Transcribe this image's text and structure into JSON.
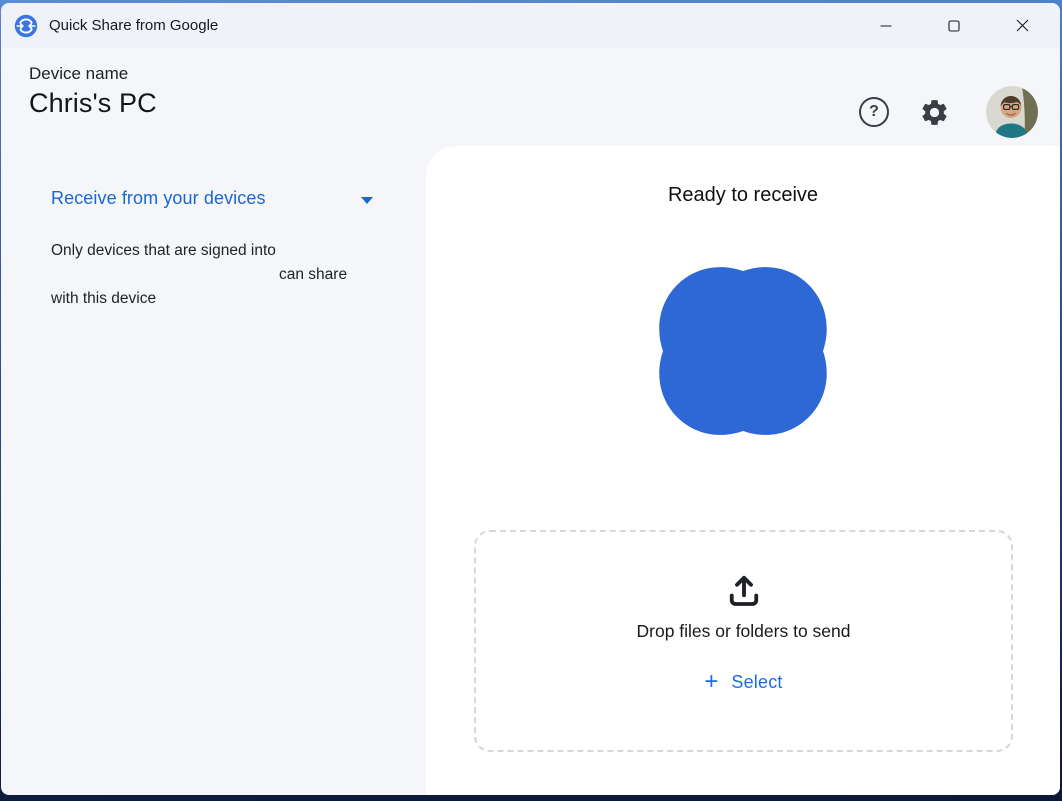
{
  "window": {
    "title": "Quick Share from Google"
  },
  "header": {
    "device_name_label": "Device name",
    "device_name": "Chris's PC",
    "help_glyph": "?"
  },
  "sidebar": {
    "mode_selector_label": "Receive from your devices",
    "description_line1": "Only devices that are signed into",
    "description_line2": "can share",
    "description_line3": "with this device"
  },
  "main": {
    "status_title": "Ready to receive",
    "dropzone_message": "Drop files or folders to send",
    "select_plus": "+",
    "select_label": "Select"
  },
  "colors": {
    "accent_blue": "#1967d2",
    "select_blue": "#1a6ce8",
    "blob_blue": "#2e68d5",
    "app_icon_blue": "#3b76e0"
  }
}
